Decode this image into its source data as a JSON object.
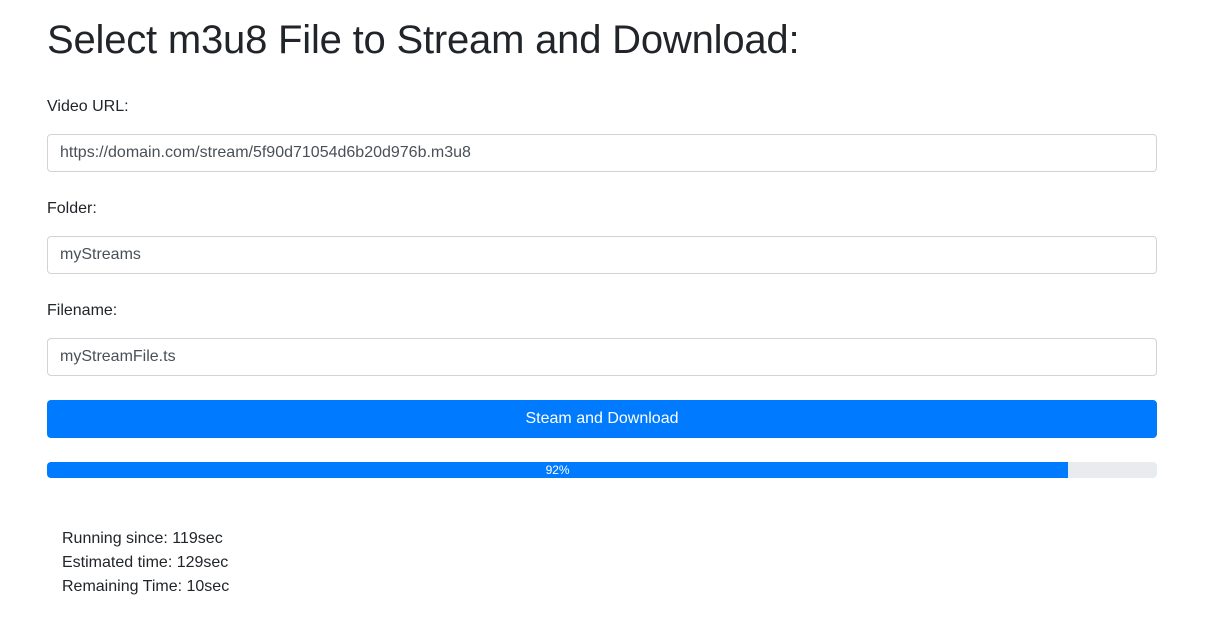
{
  "page": {
    "title": "Select m3u8 File to Stream and Download:"
  },
  "form": {
    "video_url": {
      "label": "Video URL:",
      "value": "https://domain.com/stream/5f90d71054d6b20d976b.m3u8"
    },
    "folder": {
      "label": "Folder:",
      "value": "myStreams"
    },
    "filename": {
      "label": "Filename:",
      "value": "myStreamFile.ts"
    },
    "submit_label": "Steam and Download"
  },
  "progress": {
    "value": 92,
    "text": "92%"
  },
  "stats": {
    "running_since": "Running since: 119sec",
    "estimated_time": "Estimated time: 129sec",
    "remaining_time": "Remaining Time: 10sec"
  },
  "colors": {
    "primary": "#007bff",
    "progress_track": "#e9ecef",
    "text": "#212529",
    "input_border": "#ced4da"
  }
}
